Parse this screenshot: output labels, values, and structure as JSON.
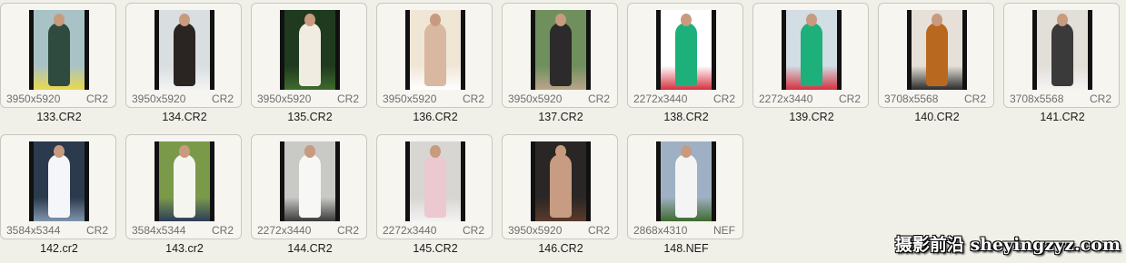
{
  "files": [
    {
      "name": "133.CR2",
      "dims": "3950x5920",
      "ext": "CR2",
      "bg": "#a9c2c5",
      "subject": "#2f4a3f",
      "accent": "#e8d94c"
    },
    {
      "name": "134.CR2",
      "dims": "3950x5920",
      "ext": "CR2",
      "bg": "#d9dee0",
      "subject": "#2a2422",
      "accent": "#f3f3f3"
    },
    {
      "name": "135.CR2",
      "dims": "3950x5920",
      "ext": "CR2",
      "bg": "#1f3a1f",
      "subject": "#f0ece2",
      "accent": "#3e6b2e"
    },
    {
      "name": "136.CR2",
      "dims": "3950x5920",
      "ext": "CR2",
      "bg": "#efe6d6",
      "subject": "#d8b8a0",
      "accent": "#ffffff"
    },
    {
      "name": "137.CR2",
      "dims": "3950x5920",
      "ext": "CR2",
      "bg": "#6f8f5c",
      "subject": "#2c2a2a",
      "accent": "#b9a58c"
    },
    {
      "name": "138.CR2",
      "dims": "2272x3440",
      "ext": "CR2",
      "bg": "#ffffff",
      "subject": "#1db07a",
      "accent": "#d6303e"
    },
    {
      "name": "139.CR2",
      "dims": "2272x3440",
      "ext": "CR2",
      "bg": "#d2dde4",
      "subject": "#1db07a",
      "accent": "#d6303e"
    },
    {
      "name": "140.CR2",
      "dims": "3708x5568",
      "ext": "CR2",
      "bg": "#e6e0d8",
      "subject": "#b9681f",
      "accent": "#2a2a2a"
    },
    {
      "name": "141.CR2",
      "dims": "3708x5568",
      "ext": "CR2",
      "bg": "#e2ded8",
      "subject": "#3a3a3a",
      "accent": "#f4f4f4"
    },
    {
      "name": "142.cr2",
      "dims": "3584x5344",
      "ext": "CR2",
      "bg": "#2b3a4d",
      "subject": "#f4f6fa",
      "accent": "#7f95ad"
    },
    {
      "name": "143.cr2",
      "dims": "3584x5344",
      "ext": "CR2",
      "bg": "#7a9a4a",
      "subject": "#f5f5f0",
      "accent": "#2e3c5a"
    },
    {
      "name": "144.CR2",
      "dims": "2272x3440",
      "ext": "CR2",
      "bg": "#c9c9c6",
      "subject": "#f7f7f5",
      "accent": "#3b3b3b"
    },
    {
      "name": "145.CR2",
      "dims": "2272x3440",
      "ext": "CR2",
      "bg": "#d8d6d2",
      "subject": "#ecc8d0",
      "accent": "#f2f2f2"
    },
    {
      "name": "146.CR2",
      "dims": "3950x5920",
      "ext": "CR2",
      "bg": "#2a2625",
      "subject": "#c79c83",
      "accent": "#5a3a2a"
    },
    {
      "name": "148.NEF",
      "dims": "2868x4310",
      "ext": "NEF",
      "bg": "#9fb0c4",
      "subject": "#f4f4f4",
      "accent": "#3f6a2e"
    }
  ],
  "watermark": "摄影前沿 sheyingzyz.com"
}
